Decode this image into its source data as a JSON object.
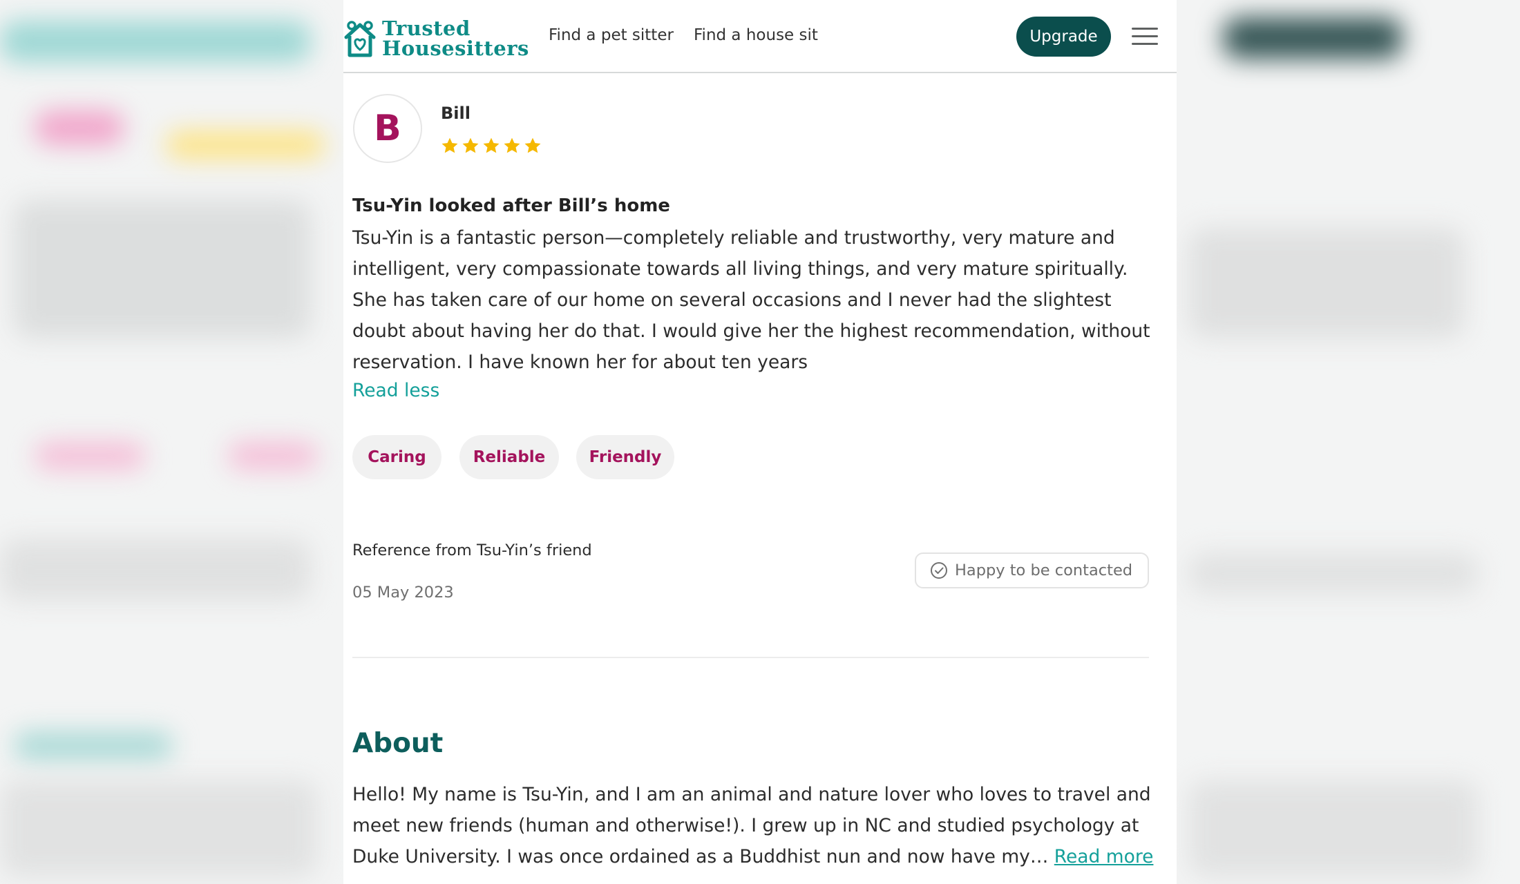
{
  "header": {
    "logo_line1": "Trusted",
    "logo_line2": "Housesitters",
    "nav_find_sitter": "Find a pet sitter",
    "nav_find_house_sit": "Find a house sit",
    "upgrade_label": "Upgrade",
    "menu_icon": "hamburger-menu-icon"
  },
  "review": {
    "avatar_initial": "B",
    "reviewer_name": "Bill",
    "rating": 5,
    "title": "Tsu-Yin looked after Bill’s home",
    "body": "Tsu-Yin is a fantastic person—completely reliable and trustworthy, very mature and intelligent, very compassionate towards all living things, and very mature spiritually. She has taken care of our home on several occasions and I never had the slightest doubt about having her do that. I would give her the highest recommendation, without reservation. I have known her for about ten years",
    "read_less": "Read less",
    "tags": [
      "Caring",
      "Reliable",
      "Friendly"
    ],
    "reference_from": "Reference from Tsu-Yin’s friend",
    "date": "05 May 2023",
    "contact_label": "Happy to be contacted",
    "contact_icon": "check-circle-icon"
  },
  "about": {
    "title": "About",
    "body": "Hello! My name is Tsu-Yin, and I am an animal and nature lover who loves to travel and meet new friends (human and otherwise!). I grew up in NC and studied psychology at Duke University. I was once ordained as a Buddhist nun and now have my…",
    "read_more": "Read more"
  },
  "colors": {
    "brand_teal": "#0e8b86",
    "dark_teal": "#0b4e4d",
    "accent_magenta": "#a4135c",
    "star_gold": "#f5b800",
    "link_teal": "#14a09a"
  }
}
